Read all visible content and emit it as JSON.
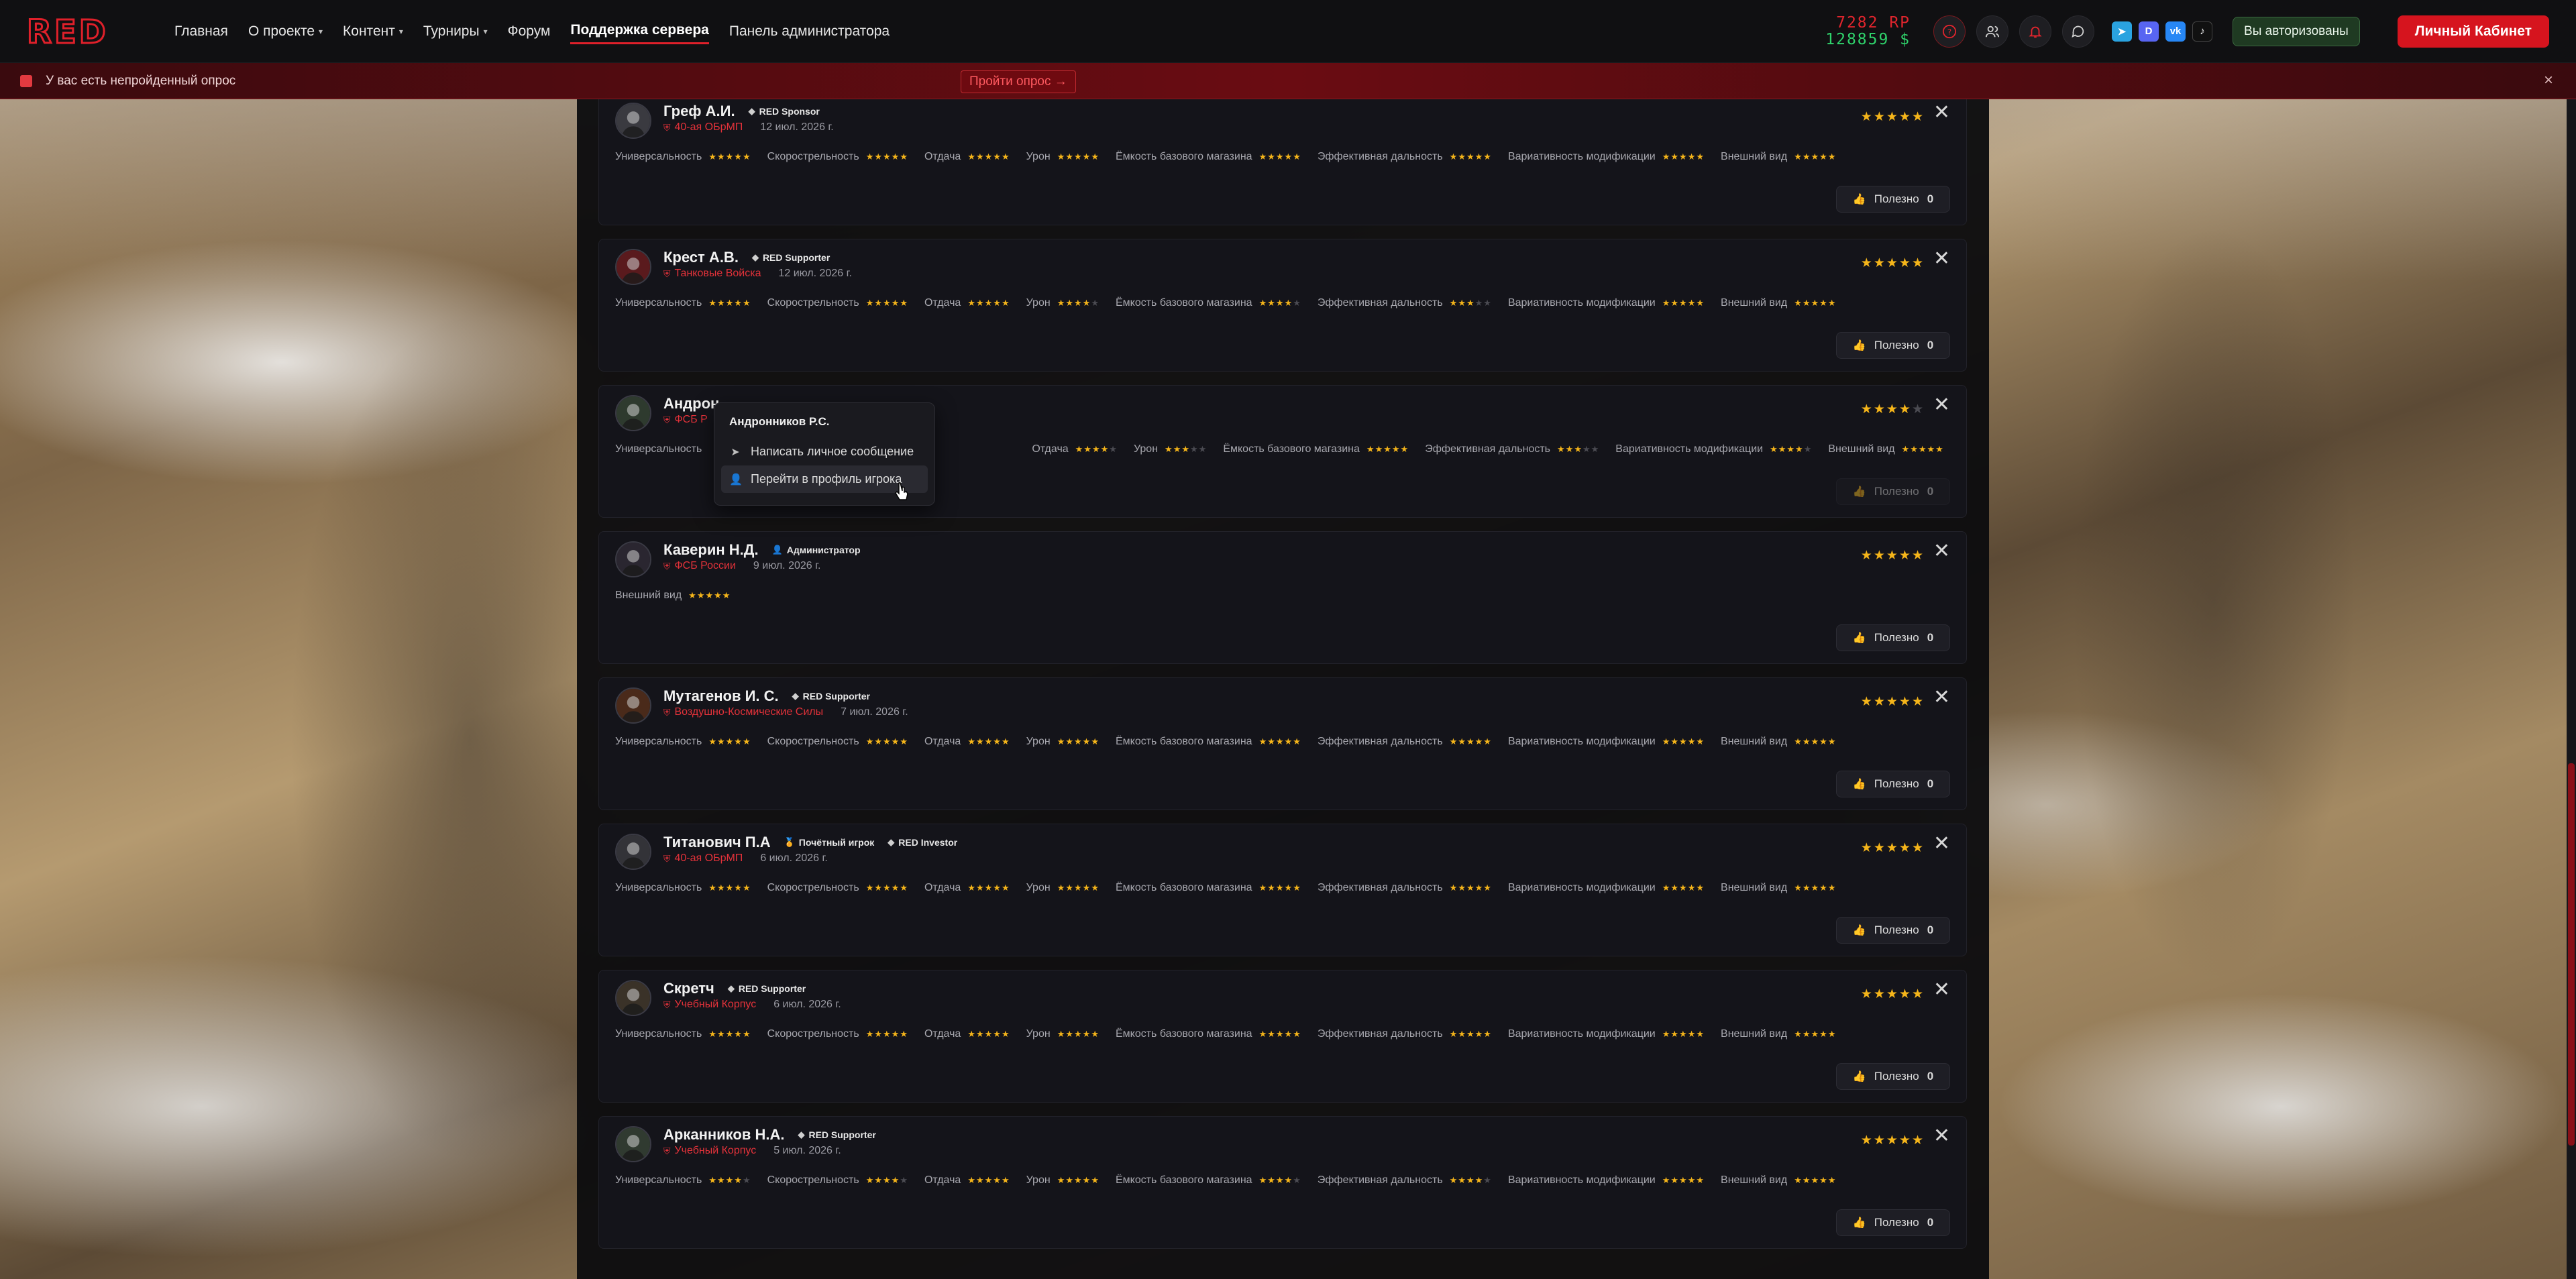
{
  "nav": {
    "logo_text": "RED",
    "items": [
      {
        "label": "Главная",
        "has_caret": false
      },
      {
        "label": "О проекте",
        "has_caret": true
      },
      {
        "label": "Контент",
        "has_caret": true
      },
      {
        "label": "Турниры",
        "has_caret": true
      },
      {
        "label": "Форум",
        "has_caret": false
      },
      {
        "label": "Поддержка сервера",
        "has_caret": false,
        "active": true
      },
      {
        "label": "Панель администратора",
        "has_caret": false
      }
    ]
  },
  "header": {
    "rp": "7282 RP",
    "money": "128859 $",
    "auth_status": "Вы авторизованы",
    "cabinet_button": "Личный Кабинет",
    "icons": [
      "help-icon",
      "users-icon",
      "bell-icon",
      "chat-icon"
    ],
    "social": [
      "telegram-icon",
      "discord-icon",
      "vk-icon",
      "tiktok-icon"
    ]
  },
  "banner": {
    "text": "У вас есть непройденный опрос",
    "link": "Пройти опрос →",
    "close": "×"
  },
  "criteria_labels": {
    "universal": "Универсальность",
    "rate": "Скорострельность",
    "recoil": "Отдача",
    "damage": "Урон",
    "mag": "Ёмкость базового магазина",
    "range": "Эффективная дальность",
    "mods": "Вариативность модификации",
    "look": "Внешний вид"
  },
  "useful_label": "Полезно",
  "reviews": [
    {
      "name": "Греф А.И.",
      "badges": [
        {
          "icon": "diamond",
          "text": "RED Sponsor"
        }
      ],
      "unit": "40-ая ОБрМП",
      "date": "12 июл. 2026 г.",
      "rating": 5,
      "criteria": [
        5,
        5,
        5,
        5,
        5,
        5,
        5,
        5
      ],
      "useful": "0"
    },
    {
      "name": "Крест А.В.",
      "badges": [
        {
          "icon": "diamond",
          "text": "RED Supporter"
        }
      ],
      "unit": "Танковые Войска",
      "date": "12 июл. 2026 г.",
      "rating": 5,
      "criteria": [
        5,
        5,
        5,
        4,
        4,
        3,
        5,
        5
      ],
      "useful": "0"
    },
    {
      "name": "Андрон",
      "badges": [],
      "unit": "ФСБ Р",
      "date": "",
      "rating": 4,
      "criteria": [
        null,
        null,
        4,
        3,
        5,
        3,
        4,
        5
      ],
      "useful": "0",
      "dim": true
    },
    {
      "name": "Каверин Н.Д.",
      "badges": [
        {
          "icon": "user",
          "text": "Администратор"
        }
      ],
      "unit": "ФСБ России",
      "date": "9 июл. 2026 г.",
      "rating": 5,
      "criteria": [
        null,
        null,
        null,
        null,
        null,
        null,
        null,
        5
      ],
      "useful": "0"
    },
    {
      "name": "Мутагенов И. С.",
      "badges": [
        {
          "icon": "diamond",
          "text": "RED Supporter"
        }
      ],
      "unit": "Воздушно-Космические Силы",
      "date": "7 июл. 2026 г.",
      "rating": 5,
      "criteria": [
        5,
        5,
        5,
        5,
        5,
        5,
        5,
        5
      ],
      "useful": "0"
    },
    {
      "name": "Титанович П.А",
      "badges": [
        {
          "icon": "medal",
          "text": "Почётный игрок"
        },
        {
          "icon": "diamond",
          "text": "RED Investor"
        }
      ],
      "unit": "40-ая ОБрМП",
      "date": "6 июл. 2026 г.",
      "rating": 5,
      "criteria": [
        5,
        5,
        5,
        5,
        5,
        5,
        5,
        5
      ],
      "useful": "0"
    },
    {
      "name": "Скретч",
      "badges": [
        {
          "icon": "diamond",
          "text": "RED Supporter"
        }
      ],
      "unit": "Учебный Корпус",
      "date": "6 июл. 2026 г.",
      "rating": 5,
      "criteria": [
        5,
        5,
        5,
        5,
        5,
        5,
        5,
        5
      ],
      "useful": "0"
    },
    {
      "name": "Арканников Н.А.",
      "badges": [
        {
          "icon": "diamond",
          "text": "RED Supporter"
        }
      ],
      "unit": "Учебный Корпус",
      "date": "5 июл. 2026 г.",
      "rating": 5,
      "criteria": [
        4,
        4,
        5,
        5,
        4,
        4,
        5,
        5
      ],
      "useful": "0"
    }
  ],
  "context_menu": {
    "title": "Андронников Р.С.",
    "items": [
      {
        "icon": "send-icon",
        "label": "Написать личное сообщение"
      },
      {
        "icon": "user-icon",
        "label": "Перейти в профиль игрока"
      }
    ]
  },
  "colors": {
    "accent": "#d6141e",
    "star": "#f5b51a",
    "unit": "#e5323a",
    "green": "#2fd36b"
  }
}
